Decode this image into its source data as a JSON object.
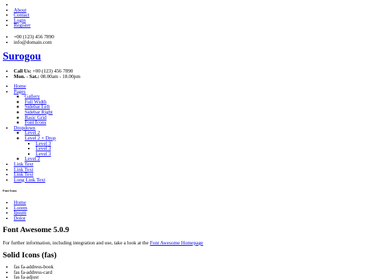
{
  "top_links": [
    "About",
    "Contact",
    "Login",
    "Register"
  ],
  "contact": {
    "phone": "+00 (123) 456 7890",
    "email": "info@domain.com"
  },
  "brand": "Surogou",
  "info": {
    "call_label": "Call Us:",
    "call_value": " +00 (123) 456 7890",
    "hours_label": "Mon. - Sat.:",
    "hours_value": " 08.00am - 18.00pm"
  },
  "nav": {
    "home": "Home",
    "pages": "Pages",
    "pages_items": [
      "Gallery",
      "Full Width",
      "Sidebar Left",
      "Sidebar Right",
      "Basic Grid",
      "Font Icons"
    ],
    "dropdown": "Dropdown",
    "level2_a": "Level 2",
    "level2_drop": "Level 2 + Drop",
    "level3": [
      "Level 3",
      "Level 3",
      "Level 3"
    ],
    "level2_b": "Level 2",
    "links": [
      "Link Text",
      "Link Text",
      "Link Text",
      "Long Link Text"
    ]
  },
  "page_small_title": "Font Icons",
  "breadcrumb": [
    "Home",
    "Lorem",
    "Ipsum",
    "Dolor"
  ],
  "fa": {
    "title": "Font Awesome 5.0.9",
    "desc_prefix": "For further information, including integration and use, take a look at the ",
    "link": "Font Awesome Homepage"
  },
  "solid": {
    "title": "Solid Icons (fas)",
    "items": [
      "fas fa-address-book",
      "fas fa-address-card",
      "fas fa-adjust"
    ]
  }
}
